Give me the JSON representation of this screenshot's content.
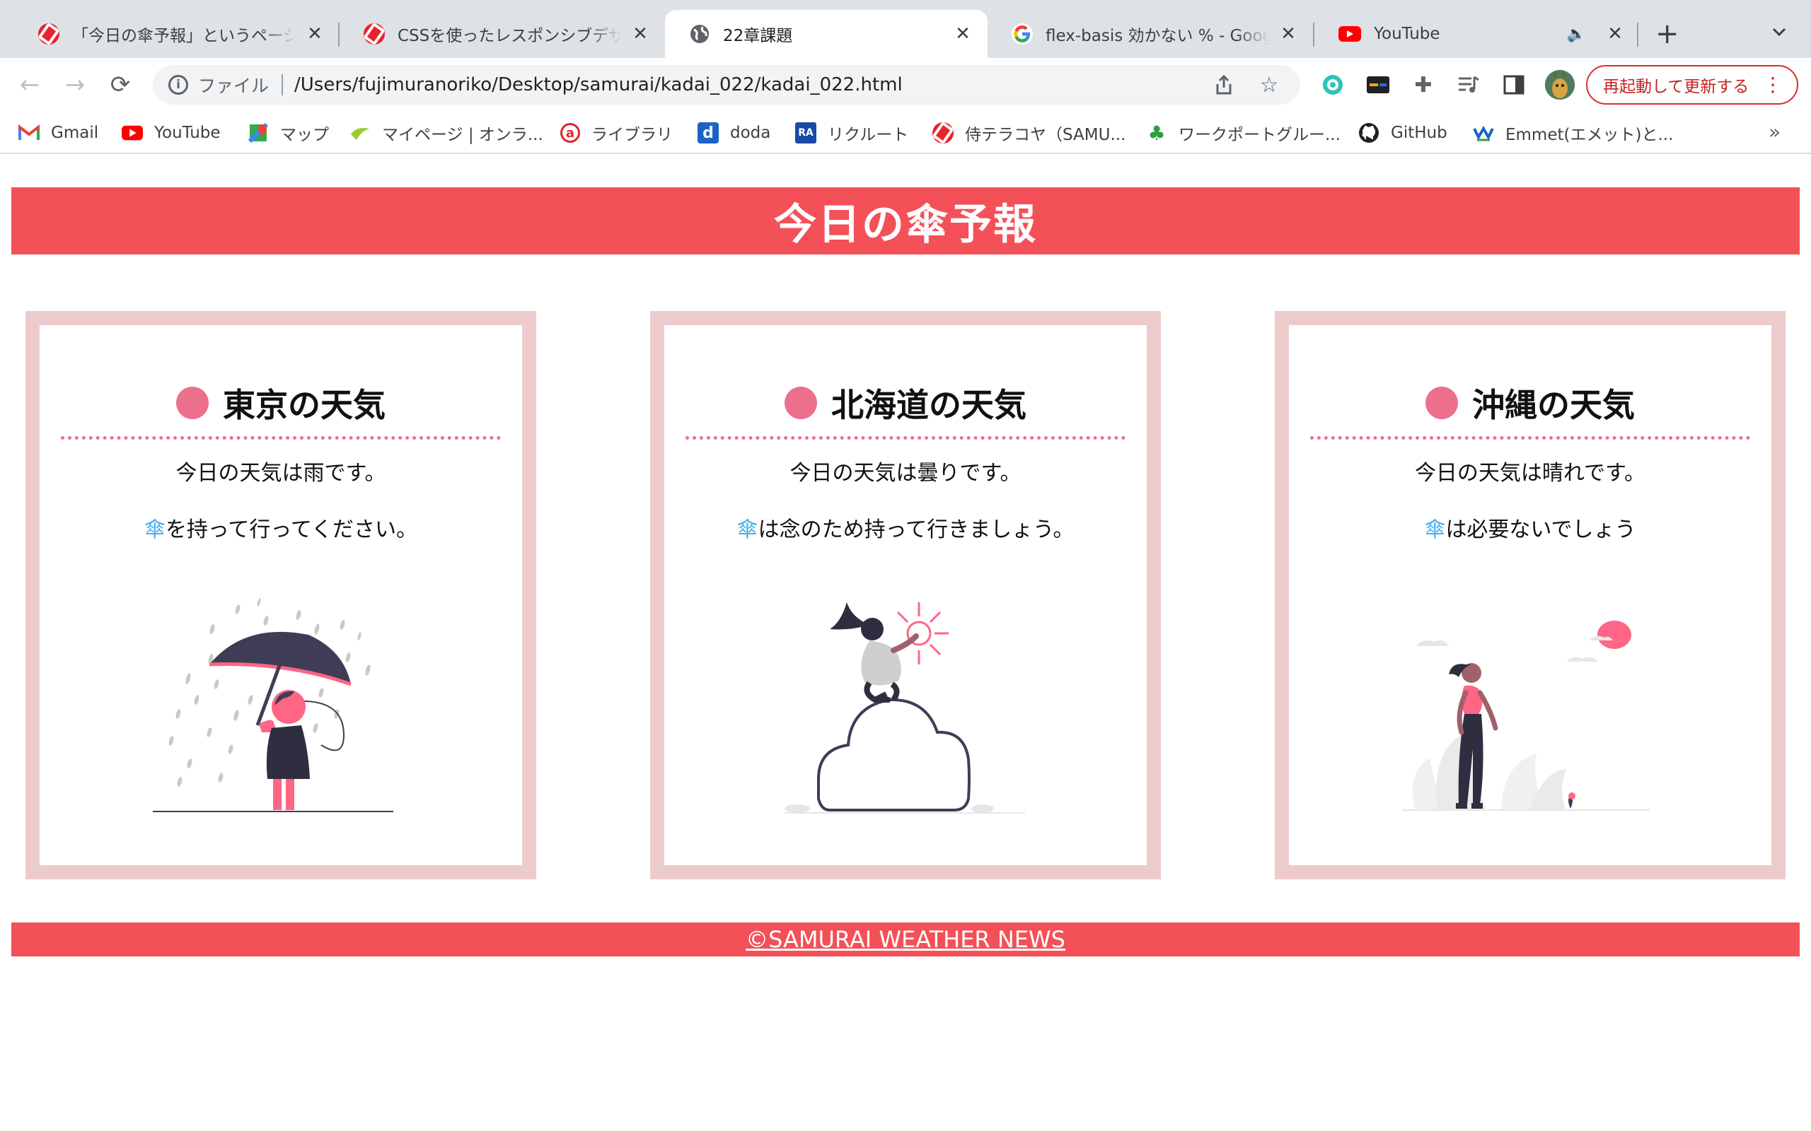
{
  "browser": {
    "tabs": [
      {
        "title": "「今日の傘予報」というページを",
        "active": false
      },
      {
        "title": "CSSを使ったレスポンシブデザイン",
        "active": false
      },
      {
        "title": "22章課題",
        "active": true
      },
      {
        "title": "flex-basis 効かない % - Google",
        "active": false
      },
      {
        "title": "YouTube",
        "active": false
      }
    ],
    "address": {
      "scheme_label": "ファイル",
      "url": "/Users/fujimuranoriko/Desktop/samurai/kadai_022/kadai_022.html"
    },
    "restart_label": "再起動して更新する",
    "bookmarks": [
      {
        "label": "Gmail"
      },
      {
        "label": "YouTube"
      },
      {
        "label": "マップ"
      },
      {
        "label": "マイページ | オンラ..."
      },
      {
        "label": "ライブラリ"
      },
      {
        "label": "doda"
      },
      {
        "label": "リクルート"
      },
      {
        "label": "侍テラコヤ（SAMU..."
      },
      {
        "label": "ワークポートグルー..."
      },
      {
        "label": "GitHub"
      },
      {
        "label": "Emmet(エメット)と..."
      }
    ],
    "more_label": "»"
  },
  "page": {
    "title": "今日の傘予報",
    "umbrella_glyph": "傘",
    "cards": [
      {
        "heading": "東京の天気",
        "weather_text": "今日の天気は雨です。",
        "advice_rest": "を持って行ってください。",
        "illustration": "rain-umbrella-illustration"
      },
      {
        "heading": "北海道の天気",
        "weather_text": "今日の天気は曇りです。",
        "advice_rest": "は念のため持って行きましょう。",
        "illustration": "cloud-climb-illustration"
      },
      {
        "heading": "沖縄の天気",
        "weather_text": "今日の天気は晴れです。",
        "advice_rest": "は必要ないでしょう",
        "illustration": "sunny-walk-illustration"
      }
    ],
    "footer_text": "©SAMURAI WEATHER NEWS"
  },
  "colors": {
    "accent": "#f45058",
    "card_border": "#edcbcd",
    "dot": "#ec6f8b",
    "umbrella_text": "#4ab0e8"
  }
}
